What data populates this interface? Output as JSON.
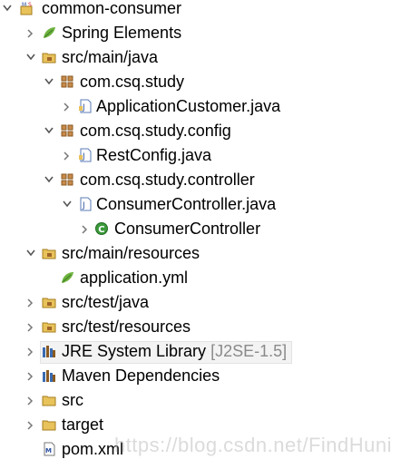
{
  "project": {
    "name": "common-consumer"
  },
  "items": [
    {
      "label": "Spring Elements"
    },
    {
      "label": "src/main/java"
    },
    {
      "label": "com.csq.study"
    },
    {
      "label": "ApplicationCustomer.java"
    },
    {
      "label": "com.csq.study.config"
    },
    {
      "label": "RestConfig.java"
    },
    {
      "label": "com.csq.study.controller"
    },
    {
      "label": "ConsumerController.java"
    },
    {
      "label": "ConsumerController"
    },
    {
      "label": "src/main/resources"
    },
    {
      "label": "application.yml"
    },
    {
      "label": "src/test/java"
    },
    {
      "label": "src/test/resources"
    },
    {
      "label": "JRE System Library",
      "decoration": "[J2SE-1.5]"
    },
    {
      "label": "Maven Dependencies"
    },
    {
      "label": "src"
    },
    {
      "label": "target"
    },
    {
      "label": "pom.xml"
    }
  ],
  "watermark": "https://blog.csdn.net/FindHuni",
  "icons": {
    "project": "maven-project-icon",
    "spring": "spring-leaf-icon",
    "source_folder": "source-folder-icon",
    "package": "package-icon",
    "java_file": "java-file-icon",
    "class": "class-icon",
    "library": "library-icon",
    "folder": "folder-icon",
    "xml": "xml-file-icon"
  },
  "colors": {
    "package": "#a0652a",
    "folder": "#e8c25a",
    "spring_leaf": "#6db33f",
    "class": "#3b9a3b",
    "java_file": "#5a7bb5"
  }
}
